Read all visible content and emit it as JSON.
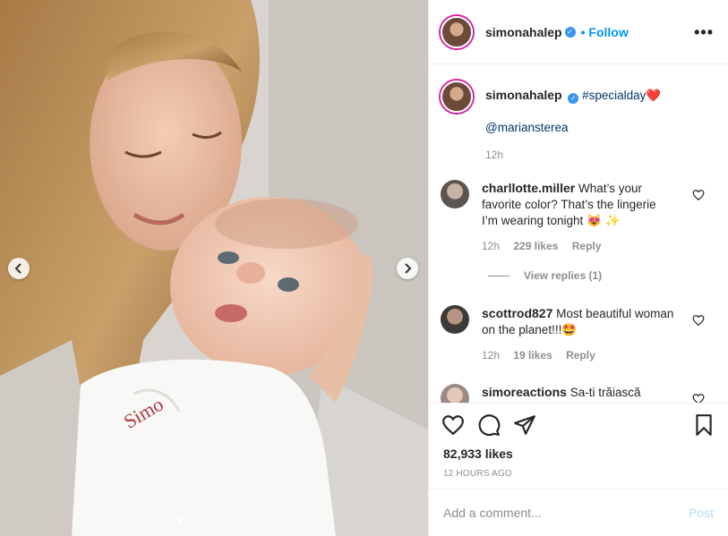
{
  "post": {
    "username": "simonahalep",
    "follow_label": "Follow",
    "separator": "•",
    "more_label": "•••",
    "caption": {
      "hashtag": "#specialday",
      "emoji": "❤️",
      "mention": "@mariansterea",
      "time": "12h"
    }
  },
  "comments": [
    {
      "username": "charllotte.miller",
      "text": "What’s your favorite color? That’s the lingerie I’m wearing tonight 😻 ✨",
      "time": "12h",
      "likes": "229 likes",
      "reply_label": "Reply",
      "view_replies": "View replies (1)"
    },
    {
      "username": "scottrod827",
      "text": "Most beautiful woman on the planet!!!🤩",
      "time": "12h",
      "likes": "19 likes",
      "reply_label": "Reply"
    },
    {
      "username": "simoreactions",
      "text": "Sa-ti trăiască"
    }
  ],
  "stats": {
    "likes": "82,933 likes",
    "posted": "12 HOURS AGO"
  },
  "comment_box": {
    "placeholder": "Add a comment...",
    "post_label": "Post"
  },
  "carousel": {
    "total_slides": 10,
    "active_index": 1
  },
  "icons": {
    "prev": "chevron-left-icon",
    "next": "chevron-right-icon",
    "like": "heart-icon",
    "comment": "comment-icon",
    "share": "paper-plane-icon",
    "save": "bookmark-icon"
  },
  "colors": {
    "link": "#0095f6",
    "verified": "#3897f0",
    "muted": "#8e8e8e"
  }
}
